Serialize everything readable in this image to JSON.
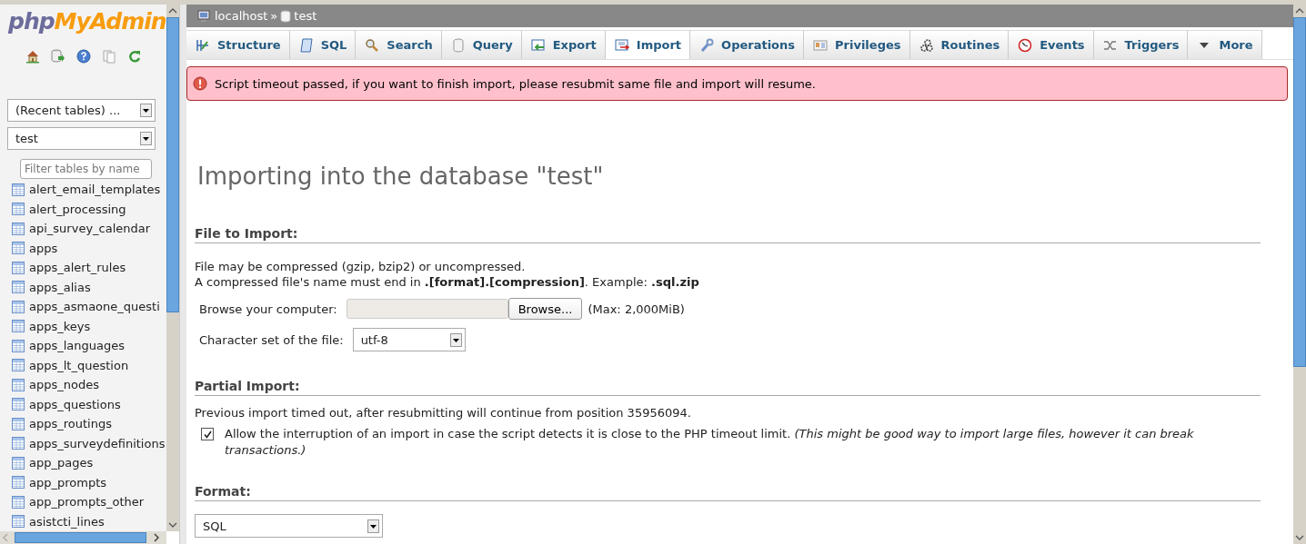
{
  "logo": {
    "parts": [
      "php",
      "MyAdmin"
    ]
  },
  "sidebar": {
    "recent": "(Recent tables) ...",
    "database": "test",
    "filter_placeholder": "Filter tables by name",
    "tables": [
      "alert_email_templates",
      "alert_processing",
      "api_survey_calendar",
      "apps",
      "apps_alert_rules",
      "apps_alias",
      "apps_asmaone_questi",
      "apps_keys",
      "apps_languages",
      "apps_lt_question",
      "apps_nodes",
      "apps_questions",
      "apps_routings",
      "apps_surveydefinitions",
      "app_pages",
      "app_prompts",
      "app_prompts_other",
      "asistcti_lines"
    ]
  },
  "breadcrumb": {
    "server": "localhost",
    "separator": "»",
    "database": "test"
  },
  "tabs": [
    {
      "label": "Structure",
      "selected": false
    },
    {
      "label": "SQL",
      "selected": false
    },
    {
      "label": "Search",
      "selected": false
    },
    {
      "label": "Query",
      "selected": false
    },
    {
      "label": "Export",
      "selected": false
    },
    {
      "label": "Import",
      "selected": true
    },
    {
      "label": "Operations",
      "selected": false
    },
    {
      "label": "Privileges",
      "selected": false
    },
    {
      "label": "Routines",
      "selected": false
    },
    {
      "label": "Events",
      "selected": false
    },
    {
      "label": "Triggers",
      "selected": false
    },
    {
      "label": "More",
      "selected": false
    }
  ],
  "error": "Script timeout passed, if you want to finish import, please resubmit same file and import will resume.",
  "title": "Importing into the database \"test\"",
  "file_section": {
    "heading": "File to Import:",
    "lines": [
      "File may be compressed (gzip, bzip2) or uncompressed.",
      "A compressed file's name must end in **.[format].[compression]**. Example: **.sql.zip**"
    ],
    "browse_label": "Browse your computer:",
    "browse_button": "Browse...",
    "max": "(Max: 2,000MiB)",
    "charset_label": "Character set of the file:",
    "charset": "utf-8"
  },
  "partial": {
    "heading": "Partial Import:",
    "note": "Previous import timed out, after resubmitting will continue from position 35956094.",
    "allow": {
      "checked": true,
      "text": "Allow the interruption of an import in case the script detects it is close to the PHP timeout limit. *(This might be good way to import large files, however it can break transactions.)*"
    }
  },
  "format": {
    "heading": "Format:",
    "value": "SQL"
  }
}
